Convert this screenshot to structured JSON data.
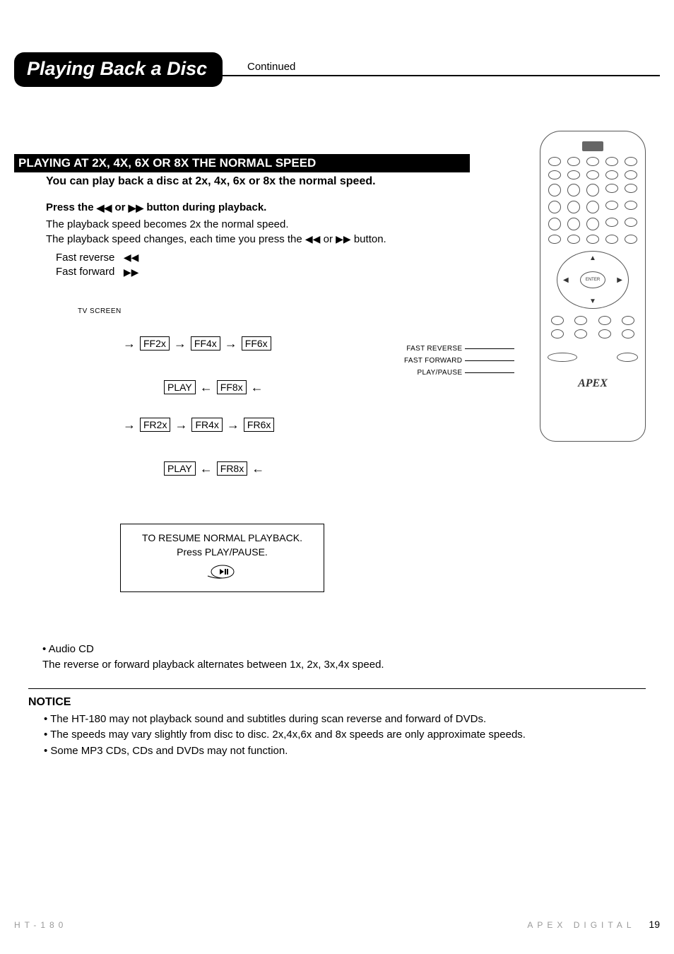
{
  "header": {
    "title": "Playing Back a Disc",
    "continued": "Continued"
  },
  "section": {
    "heading": "PLAYING AT 2X, 4X, 6X OR 8X THE NORMAL SPEED",
    "subhead": "You can play back a disc at 2x, 4x, 6x or 8x the normal speed.",
    "press_line_a": "Press the ",
    "press_line_b": " or ",
    "press_line_c": " button during playback.",
    "line1": "The playback speed becomes 2x the normal speed.",
    "line2a": "The playback speed changes, each time you press the ",
    "line2b": " or ",
    "line2c": " button.",
    "fr_label": "Fast reverse",
    "ff_label": "Fast forward",
    "tv_label": "TV SCREEN",
    "resume1": "TO RESUME NORMAL PLAYBACK.",
    "resume2": "Press PLAY/PAUSE."
  },
  "icons": {
    "rev": "◀◀",
    "fwd": "▶▶",
    "playpause": "▶❚❚"
  },
  "chart_data": {
    "type": "state-cycle",
    "ff_sequence": [
      "FF2x",
      "FF4x",
      "FF6x",
      "FF8x",
      "PLAY"
    ],
    "fr_sequence": [
      "FR2x",
      "FR4x",
      "FR6x",
      "FR8x",
      "PLAY"
    ]
  },
  "audio": {
    "head": "• Audio CD",
    "line": "The reverse or forward playback alternates between 1x, 2x, 3x,4x speed."
  },
  "notice": {
    "head": "NOTICE",
    "items": [
      "• The HT-180 may not playback sound and subtitles during scan reverse and forward of DVDs.",
      "• The speeds may vary slightly from disc to disc. 2x,4x,6x and 8x speeds are only approximate speeds.",
      "• Some MP3 CDs, CDs and  DVDs may not function."
    ]
  },
  "remote": {
    "callouts": [
      "FAST REVERSE",
      "FAST FORWARD",
      "PLAY/PAUSE"
    ],
    "brand": "APEX",
    "enter": "ENTER"
  },
  "footer": {
    "left": "HT-180",
    "right": "APEX DIGITAL",
    "page": "19"
  }
}
